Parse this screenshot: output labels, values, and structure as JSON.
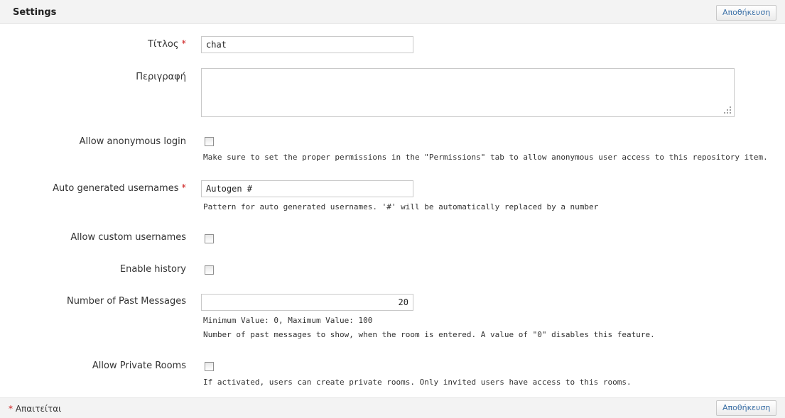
{
  "header": {
    "title": "Settings",
    "save_label": "Αποθήκευση"
  },
  "fields": {
    "title": {
      "label": "Τίτλος",
      "value": "chat",
      "required_mark": "*"
    },
    "description": {
      "label": "Περιγραφή",
      "value": ""
    },
    "anonymous_login": {
      "label": "Allow anonymous login",
      "checked": false,
      "help": "Make sure to set the proper permissions in the \"Permissions\" tab to allow anonymous user access to this repository item."
    },
    "autogen_usernames": {
      "label": "Auto generated usernames",
      "required_mark": "*",
      "value": "Autogen #",
      "help": "Pattern for auto generated usernames. '#' will be automatically replaced by a number"
    },
    "custom_usernames": {
      "label": "Allow custom usernames",
      "checked": false
    },
    "enable_history": {
      "label": "Enable history",
      "checked": false
    },
    "past_messages": {
      "label": "Number of Past Messages",
      "value": "20",
      "help_range": "Minimum Value: 0, Maximum Value: 100",
      "help": "Number of past messages to show, when the room is entered. A value of \"0\" disables this feature."
    },
    "private_rooms": {
      "label": "Allow Private Rooms",
      "checked": false,
      "help": "If activated, users can create private rooms. Only invited users have access to this rooms."
    }
  },
  "footer": {
    "required_star": "*",
    "required_note": "Απαιτείται",
    "save_label": "Αποθήκευση"
  }
}
